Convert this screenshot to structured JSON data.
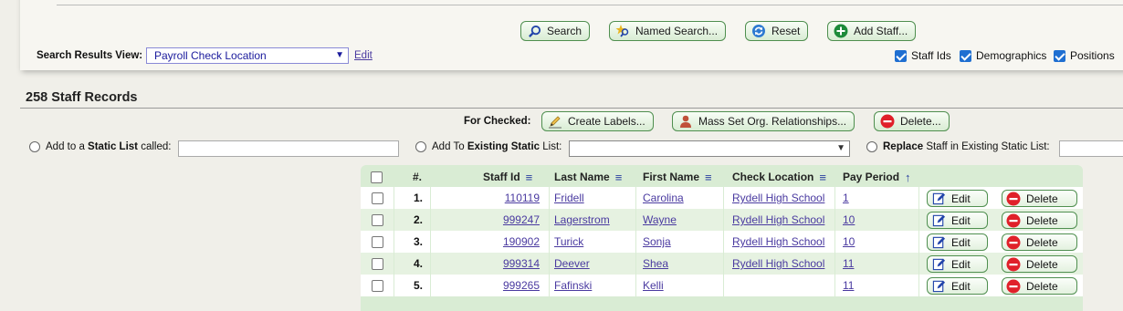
{
  "search_panel": {
    "buttons": {
      "search": "Search",
      "named_search": "Named Search...",
      "reset": "Reset",
      "add_staff": "Add Staff..."
    },
    "results_view_label": "Search Results View:",
    "results_view_value": "Payroll Check Location",
    "results_view_edit": "Edit",
    "options": [
      {
        "label": "Staff Ids",
        "checked": true
      },
      {
        "label": "Demographics",
        "checked": true
      },
      {
        "label": "Positions",
        "checked": true
      }
    ]
  },
  "records": {
    "title": "258 Staff Records",
    "for_checked_label": "For Checked:",
    "actions": {
      "create_labels": "Create Labels...",
      "mass_set": "Mass Set Org. Relationships...",
      "delete": "Delete..."
    },
    "static_list": {
      "add_prefix": "Add to a",
      "add_bold": "Static List",
      "add_suffix": "called:",
      "existing_prefix": "Add To",
      "existing_bold": "Existing Static",
      "existing_suffix": "List:",
      "replace_bold": "Replace",
      "replace_suffix": "Staff in Existing Static List:"
    }
  },
  "table": {
    "columns": [
      "#.",
      "Staff Id",
      "Last Name",
      "First Name",
      "Check Location",
      "Pay Period"
    ],
    "edit_label": "Edit",
    "delete_label": "Delete",
    "rows": [
      {
        "n": "1.",
        "staff_id": "110119",
        "last": "Fridell",
        "first": "Carolina",
        "location": "Rydell High School",
        "period": "1"
      },
      {
        "n": "2.",
        "staff_id": "999247",
        "last": "Lagerstrom",
        "first": "Wayne",
        "location": "Rydell High School",
        "period": "10"
      },
      {
        "n": "3.",
        "staff_id": "190902",
        "last": "Turick",
        "first": "Sonja",
        "location": "Rydell High School",
        "period": "10"
      },
      {
        "n": "4.",
        "staff_id": "999314",
        "last": "Deever",
        "first": "Shea",
        "location": "Rydell High School",
        "period": "11"
      },
      {
        "n": "5.",
        "staff_id": "999265",
        "last": "Fafinski",
        "first": "Kelli",
        "location": "",
        "period": "11"
      }
    ]
  },
  "colors": {
    "accent_green": "#a6d1a1",
    "link": "#4a3aa0",
    "delete_red": "#e0202a",
    "check_blue": "#1f6fd1"
  }
}
